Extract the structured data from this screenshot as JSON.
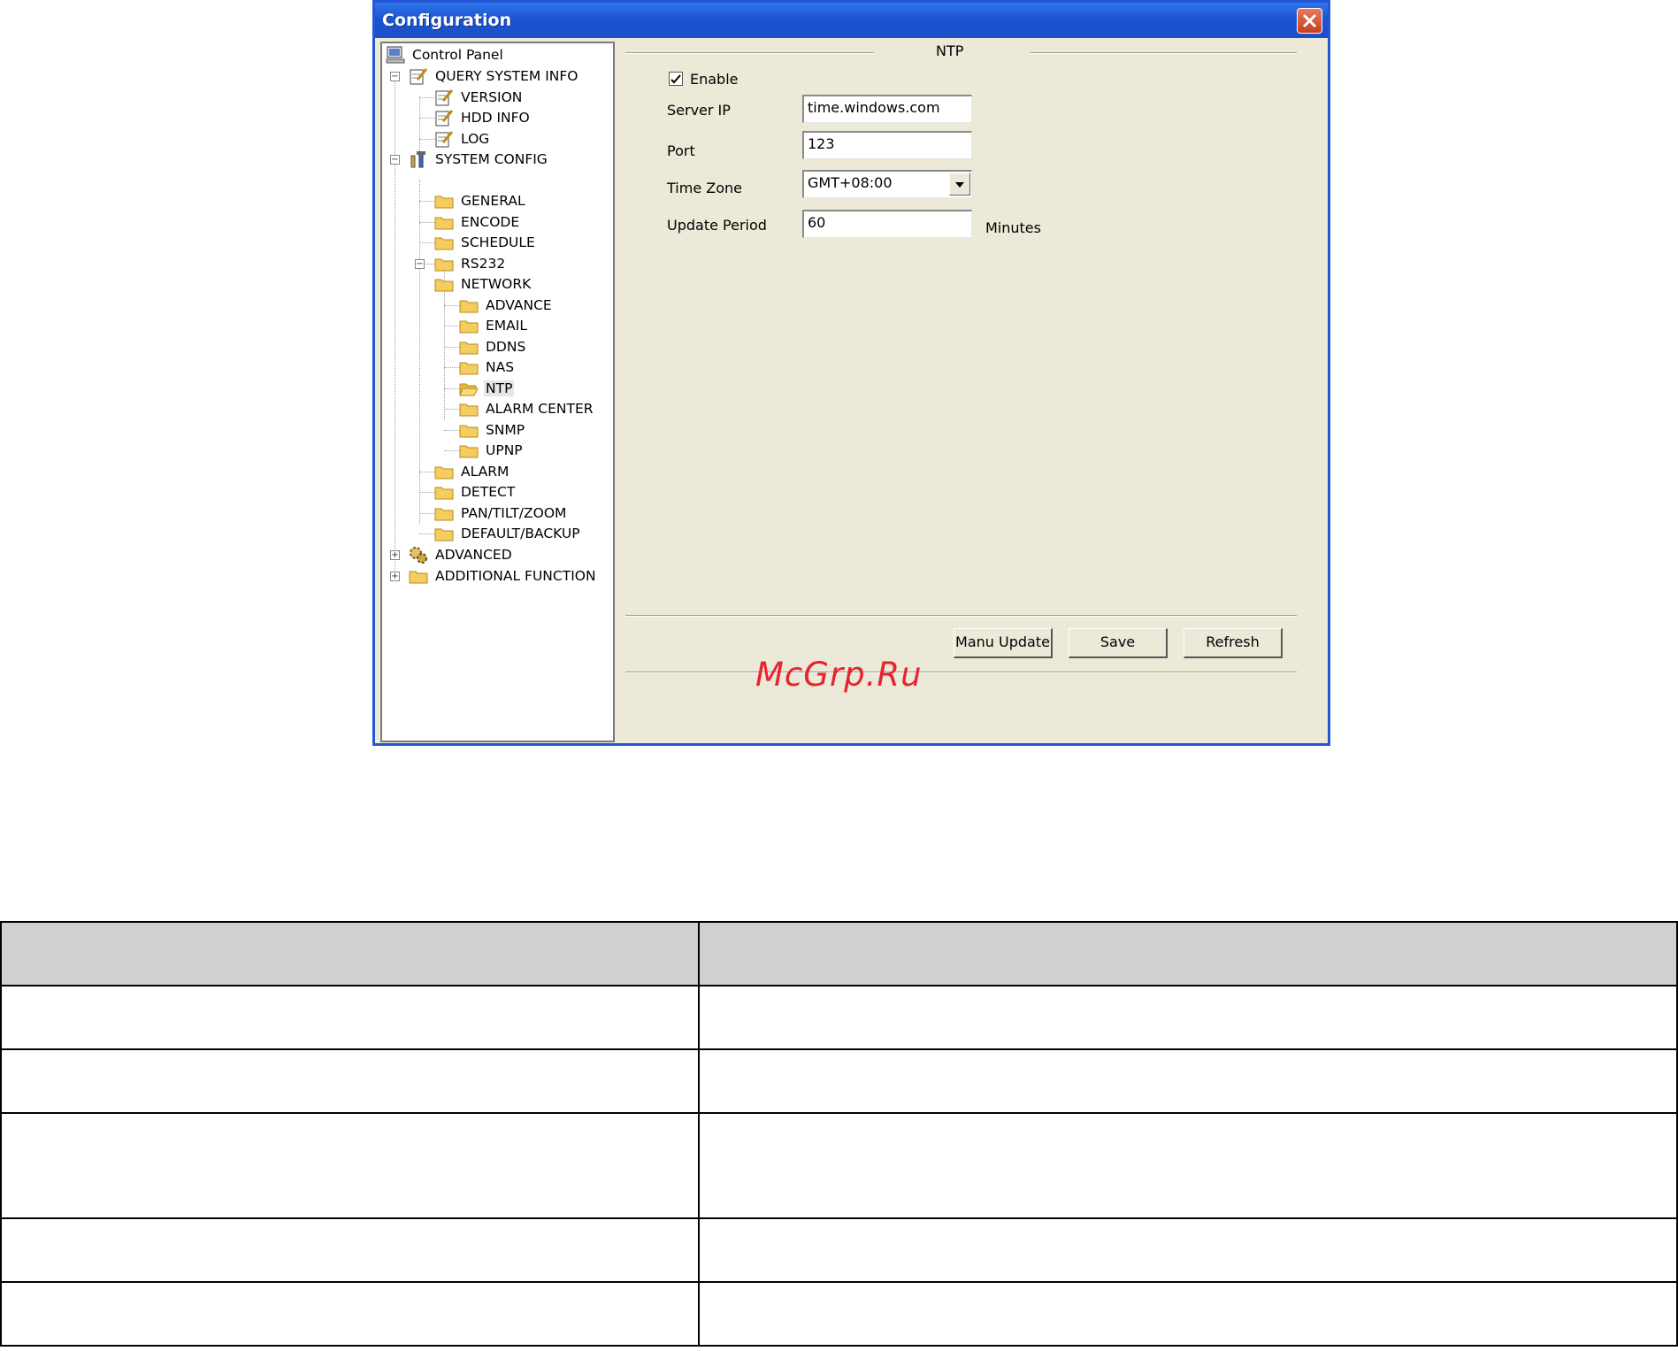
{
  "window": {
    "title": "Configuration",
    "accent": "#2457d6"
  },
  "tree": {
    "items": [
      {
        "label": "Control Panel",
        "icon": "computer-icon"
      },
      {
        "label": "QUERY SYSTEM INFO",
        "icon": "notepad-icon"
      },
      {
        "label": "VERSION",
        "icon": "notepad-icon"
      },
      {
        "label": "HDD INFO",
        "icon": "notepad-icon"
      },
      {
        "label": "LOG",
        "icon": "notepad-icon"
      },
      {
        "label": "SYSTEM CONFIG",
        "icon": "tools-icon"
      },
      {
        "label": "GENERAL",
        "icon": "folder-icon"
      },
      {
        "label": "ENCODE",
        "icon": "folder-icon"
      },
      {
        "label": "SCHEDULE",
        "icon": "folder-icon"
      },
      {
        "label": "RS232",
        "icon": "folder-icon"
      },
      {
        "label": "NETWORK",
        "icon": "folder-icon"
      },
      {
        "label": "ADVANCE",
        "icon": "folder-icon"
      },
      {
        "label": "EMAIL",
        "icon": "folder-icon"
      },
      {
        "label": "DDNS",
        "icon": "folder-icon"
      },
      {
        "label": "NAS",
        "icon": "folder-icon"
      },
      {
        "label": "NTP",
        "icon": "open-folder-icon"
      },
      {
        "label": "ALARM CENTER",
        "icon": "folder-icon"
      },
      {
        "label": "SNMP",
        "icon": "folder-icon"
      },
      {
        "label": "UPNP",
        "icon": "folder-icon"
      },
      {
        "label": "ALARM",
        "icon": "folder-icon"
      },
      {
        "label": "DETECT",
        "icon": "folder-icon"
      },
      {
        "label": "PAN/TILT/ZOOM",
        "icon": "folder-icon"
      },
      {
        "label": "DEFAULT/BACKUP",
        "icon": "folder-icon"
      },
      {
        "label": "ADVANCED",
        "icon": "gears-icon"
      },
      {
        "label": "ADDITIONAL FUNCTION",
        "icon": "folder-icon"
      }
    ],
    "selected": "NTP"
  },
  "ntp": {
    "group_title": "NTP",
    "enable_label": "Enable",
    "enable_checked": true,
    "server_ip_label": "Server IP",
    "server_ip_value": "time.windows.com",
    "port_label": "Port",
    "port_value": "123",
    "time_zone_label": "Time Zone",
    "time_zone_value": "GMT+08:00",
    "update_period_label": "Update Period",
    "update_period_value": "60",
    "update_period_unit": "Minutes"
  },
  "buttons": {
    "manu_update": "Manu Update",
    "save": "Save",
    "refresh": "Refresh"
  },
  "watermark": "McGrp.Ru"
}
